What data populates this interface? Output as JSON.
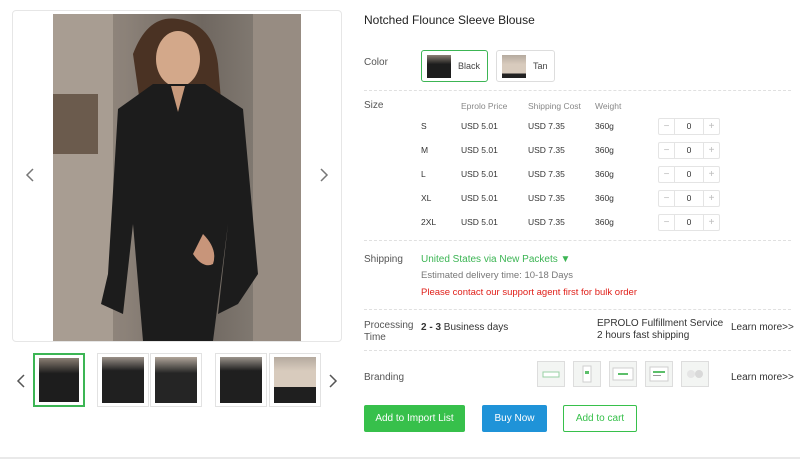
{
  "product": {
    "title": "Notched Flounce Sleeve Blouse"
  },
  "gallery": {
    "prev_icon": "chevron-left-icon",
    "next_icon": "chevron-right-icon",
    "thumbnails": [
      "Black front",
      "Black full",
      "Black side",
      "Black posed",
      "Tan full"
    ]
  },
  "color": {
    "label": "Color",
    "options": [
      {
        "name": "Black",
        "selected": true
      },
      {
        "name": "Tan",
        "selected": false
      }
    ]
  },
  "size": {
    "label": "Size",
    "headers": {
      "price": "Eprolo Price",
      "shipping": "Shipping Cost",
      "weight": "Weight"
    },
    "rows": [
      {
        "size": "S",
        "price": "USD 5.01",
        "shipping": "USD 7.35",
        "weight": "360g",
        "qty": "0"
      },
      {
        "size": "M",
        "price": "USD 5.01",
        "shipping": "USD 7.35",
        "weight": "360g",
        "qty": "0"
      },
      {
        "size": "L",
        "price": "USD 5.01",
        "shipping": "USD 7.35",
        "weight": "360g",
        "qty": "0"
      },
      {
        "size": "XL",
        "price": "USD 5.01",
        "shipping": "USD 7.35",
        "weight": "360g",
        "qty": "0"
      },
      {
        "size": "2XL",
        "price": "USD 5.01",
        "shipping": "USD 7.35",
        "weight": "360g",
        "qty": "0"
      }
    ],
    "minus": "−",
    "plus": "+"
  },
  "shipping": {
    "label": "Shipping",
    "method": "United States via New Packets ▼",
    "estimate": "Estimated delivery time: 10-18 Days",
    "notice": "Please contact our support agent first for bulk order"
  },
  "processing": {
    "label_line1": "Processing",
    "label_line2": "Time",
    "days_range": "2 - 3",
    "days_unit": " Business days",
    "service_title": "EPROLO Fulfillment Service",
    "service_sub": "2 hours fast shipping",
    "learn_more": "Learn more>>"
  },
  "branding": {
    "label": "Branding",
    "items": [
      "branding-sample-1",
      "branding-sample-2",
      "branding-sample-3",
      "branding-sample-4",
      "branding-sample-5"
    ],
    "learn_more": "Learn more>>"
  },
  "actions": {
    "import": "Add to Import List",
    "buy": "Buy Now",
    "cart": "Add to cart"
  },
  "colors": {
    "accent_green": "#37c04b",
    "buy_blue": "#1f93d8",
    "warning_red": "#e0201a"
  }
}
